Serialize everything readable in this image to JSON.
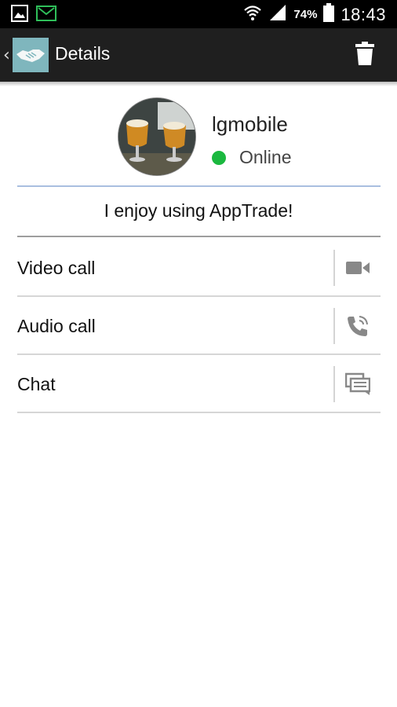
{
  "status_bar": {
    "battery_percent": "74%",
    "time": "18:43",
    "icons": [
      "gallery-icon",
      "message-icon",
      "wifi-icon",
      "signal-icon",
      "battery-icon"
    ]
  },
  "app_bar": {
    "title": "Details",
    "logo": "handshake-logo",
    "actions": [
      "back-icon",
      "trash-icon"
    ]
  },
  "profile": {
    "username": "lgmobile",
    "presence": "Online",
    "presence_color": "#1bb83f",
    "status_message": "I enjoy using AppTrade!"
  },
  "actions": [
    {
      "label": "Video call",
      "icon": "video-camera-icon"
    },
    {
      "label": "Audio call",
      "icon": "phone-icon"
    },
    {
      "label": "Chat",
      "icon": "chat-icon"
    }
  ],
  "colors": {
    "status_bar_bg": "#000000",
    "app_bar_bg": "#1f1f1f",
    "logo_bg": "#7fb6bd",
    "icon_gray": "#888888"
  }
}
